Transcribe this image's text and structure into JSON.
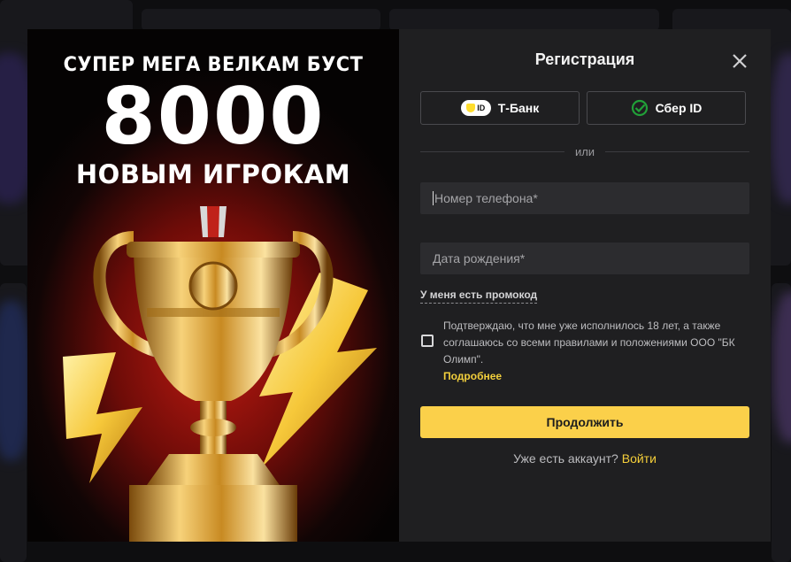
{
  "promo": {
    "line1": "СУПЕР МЕГА ВЕЛКАМ БУСТ",
    "amount": "8000",
    "line3": "НОВЫМ ИГРОКАМ"
  },
  "form": {
    "title": "Регистрация",
    "sso": {
      "tbank_badge": "ID",
      "tbank_label": "Т-Банк",
      "sber_label": "Сбер ID"
    },
    "divider_text": "или",
    "phone_placeholder": "Номер телефона*",
    "dob_placeholder": "Дата рождения*",
    "promo_code_link": "У меня есть промокод",
    "consent_text": "Подтверждаю, что мне уже исполнилось 18 лет, а также соглашаюсь со всеми правилами и положениями ООО \"БК Олимп\".",
    "more_link": "Подробнее",
    "continue_button": "Продолжить",
    "have_account_text": "Уже есть аккаунт?",
    "login_link": "Войти"
  },
  "colors": {
    "accent": "#fbd04a",
    "link": "#f2cf3c",
    "modal_bg": "#1f1f21",
    "field_bg": "#2c2c2f",
    "sber_green": "#21a038"
  },
  "icons": {
    "close": "close-icon",
    "tbank": "tbank-id-icon",
    "sber": "sber-check-icon",
    "trophy": "trophy-illustration"
  }
}
